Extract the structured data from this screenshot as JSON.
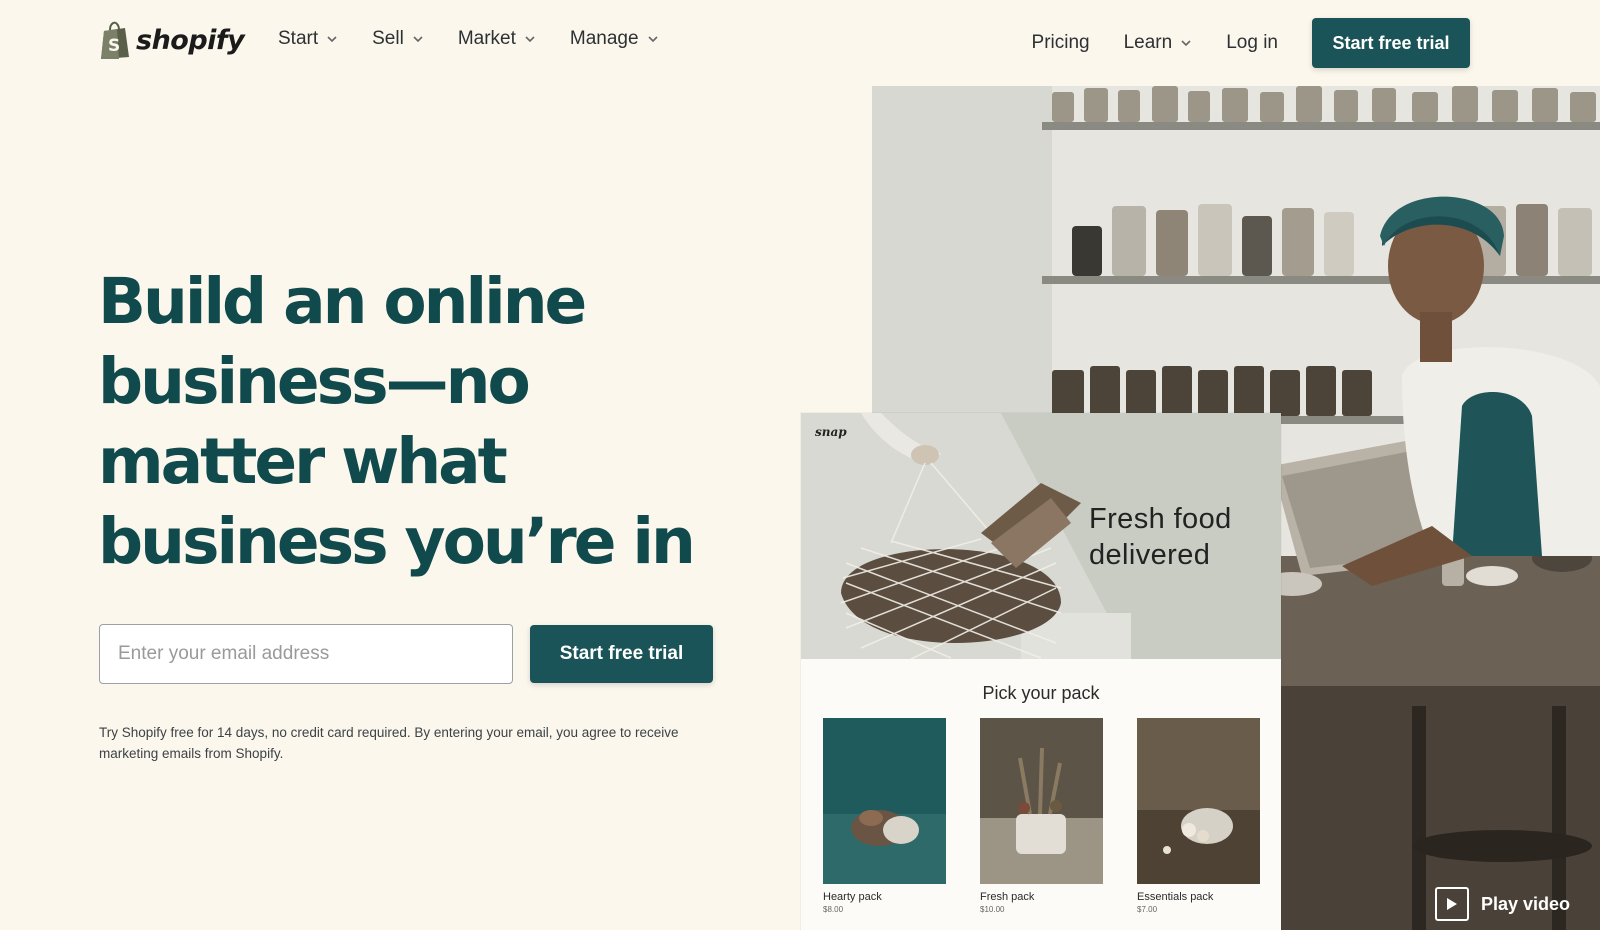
{
  "nav": {
    "brand": "shopify",
    "left_items": [
      {
        "label": "Start"
      },
      {
        "label": "Sell"
      },
      {
        "label": "Market"
      },
      {
        "label": "Manage"
      }
    ],
    "right_items": {
      "pricing": "Pricing",
      "learn": "Learn",
      "login": "Log in"
    },
    "cta": "Start free trial"
  },
  "hero": {
    "title_lines": [
      "Build an online",
      "business—no",
      "matter what",
      "business you’re in"
    ],
    "email_placeholder": "Enter your email address",
    "cta": "Start free trial",
    "disclaimer_line1": "Try Shopify free for 14 days, no credit card required. By entering your email, you agree to receive",
    "disclaimer_line2": "marketing emails from Shopify."
  },
  "store_card": {
    "brand": "snap",
    "headline_line1": "Fresh food",
    "headline_line2": "delivered",
    "subheading": "Pick your pack",
    "packs": [
      {
        "name": "Hearty pack",
        "price": "$8.00"
      },
      {
        "name": "Fresh pack",
        "price": "$10.00"
      },
      {
        "name": "Essentials pack",
        "price": "$7.00"
      }
    ]
  },
  "video": {
    "label": "Play video"
  },
  "colors": {
    "brand_green": "#1a5458",
    "headline_green": "#114a4c",
    "page_bg": "#fbf7ed"
  }
}
